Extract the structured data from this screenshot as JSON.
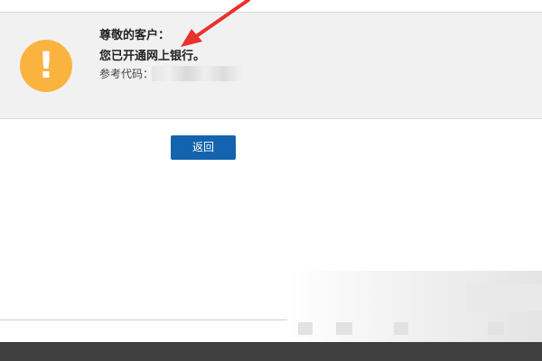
{
  "notice": {
    "greeting": "尊敬的客户：",
    "message": "您已开通网上银行。",
    "reference_label": "参考代码："
  },
  "actions": {
    "back_label": "返回"
  },
  "icons": {
    "warning": "exclamation-circle-icon",
    "annotation": "red-arrow-icon"
  },
  "colors": {
    "warning_icon": "#fbb33f",
    "button_bg": "#1363ae",
    "panel_bg": "#f1f1f1",
    "arrow": "#e8322c",
    "footer": "#3f3f3f"
  }
}
